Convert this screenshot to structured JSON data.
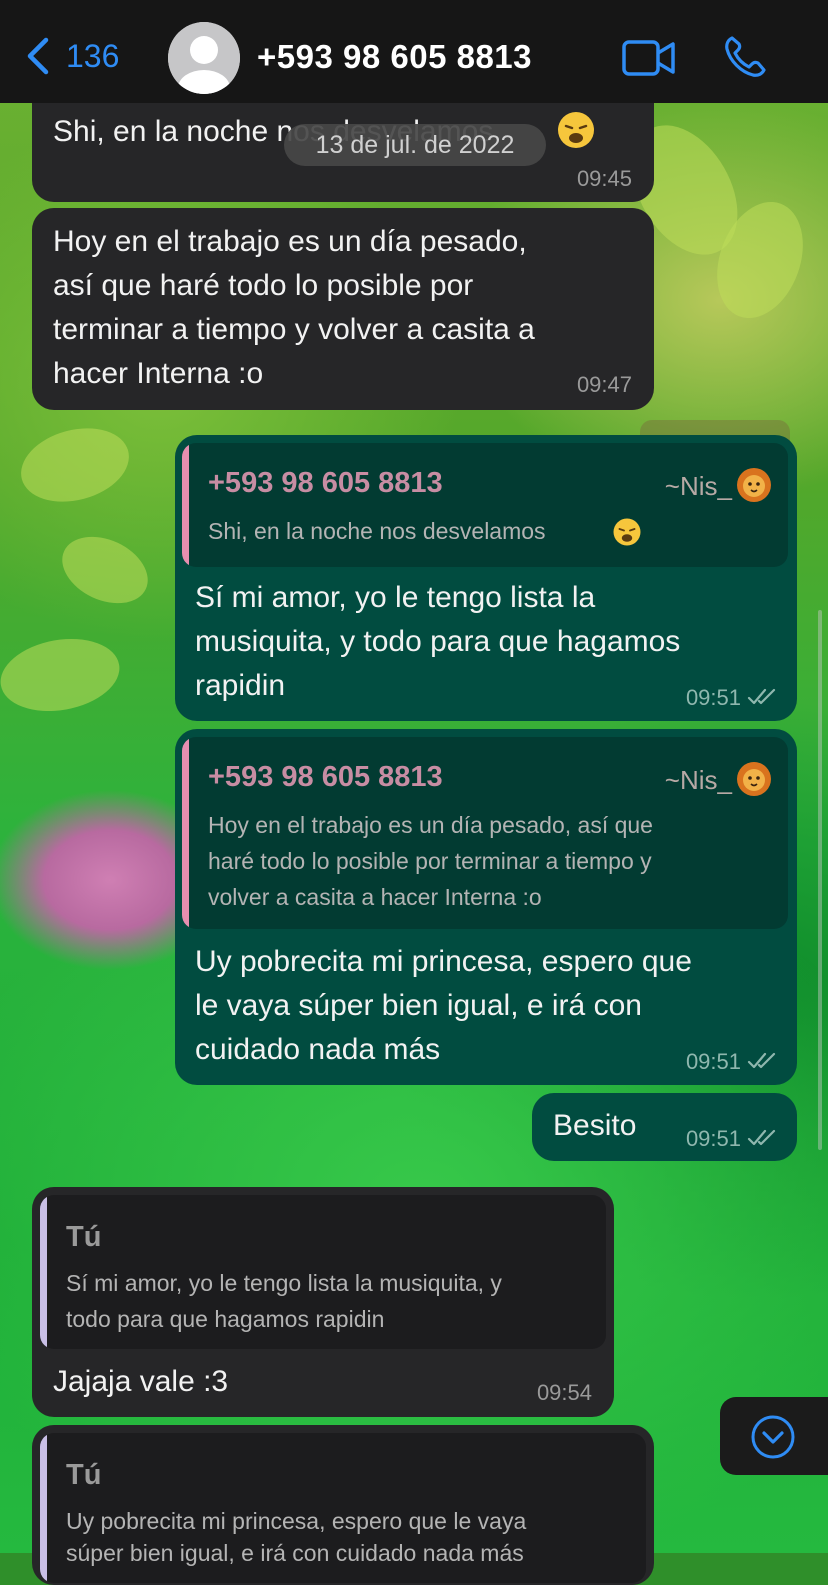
{
  "header": {
    "back_count": "136",
    "contact_name": "+593 98 605 8813"
  },
  "date_separator": "13 de jul. de 2022",
  "messages": [
    {
      "id": "m1",
      "direction": "in",
      "text": "Shi, en la noche nos desvelamos",
      "emoji": "weary-face",
      "time": "09:45"
    },
    {
      "id": "m2",
      "direction": "in",
      "lines": [
        "Hoy en el trabajo es un día pesado,",
        "así que haré todo lo posible por",
        "terminar a tiempo y volver a casita a",
        "hacer Interna :o"
      ],
      "time": "09:47"
    },
    {
      "id": "m3",
      "direction": "out",
      "quote": {
        "author": "+593 98 605 8813",
        "alias": "~Nis_",
        "alias_emoji": "lion-face",
        "lines": [
          "Shi, en la noche nos desvelamos"
        ],
        "emoji": "weary-face"
      },
      "lines": [
        "Sí mi amor, yo le tengo lista la",
        "musiquita, y todo para que hagamos",
        "rapidin"
      ],
      "time": "09:51",
      "status": "read"
    },
    {
      "id": "m4",
      "direction": "out",
      "quote": {
        "author": "+593 98 605 8813",
        "alias": "~Nis_",
        "alias_emoji": "lion-face",
        "lines": [
          "Hoy en el trabajo es un día pesado, así que",
          "haré todo lo posible por terminar a tiempo y",
          "volver a casita a hacer Interna :o"
        ]
      },
      "lines": [
        "Uy pobrecita mi princesa, espero que",
        "le vaya súper bien igual, e irá con",
        "cuidado nada más"
      ],
      "time": "09:51",
      "status": "read"
    },
    {
      "id": "m5",
      "direction": "out",
      "text": "Besito",
      "time": "09:51",
      "status": "read"
    },
    {
      "id": "m6",
      "direction": "in",
      "quote": {
        "author": "Tú",
        "lines": [
          "Sí mi amor, yo le tengo lista la musiquita, y",
          "todo para que hagamos rapidin"
        ]
      },
      "text": "Jajaja vale :3",
      "time": "09:54"
    },
    {
      "id": "m7",
      "direction": "in",
      "quote": {
        "author": "Tú",
        "lines": [
          "Uy pobrecita mi princesa, espero que le vaya",
          "súper bien igual, e irá con cuidado nada más"
        ]
      }
    }
  ],
  "colors": {
    "accent": "#2f8cf4",
    "incoming_bubble": "#262628",
    "outgoing_bubble": "#014c40",
    "quote_bar_contact": "#e58fb0",
    "quote_bar_self": "#c9bfe6",
    "quote_name_contact": "#c78da3"
  },
  "icons": {
    "back": "chevron-left-icon",
    "video": "video-camera-icon",
    "call": "phone-icon",
    "scroll_down": "chevron-down-circle-icon",
    "read_receipt": "double-check-icon"
  }
}
